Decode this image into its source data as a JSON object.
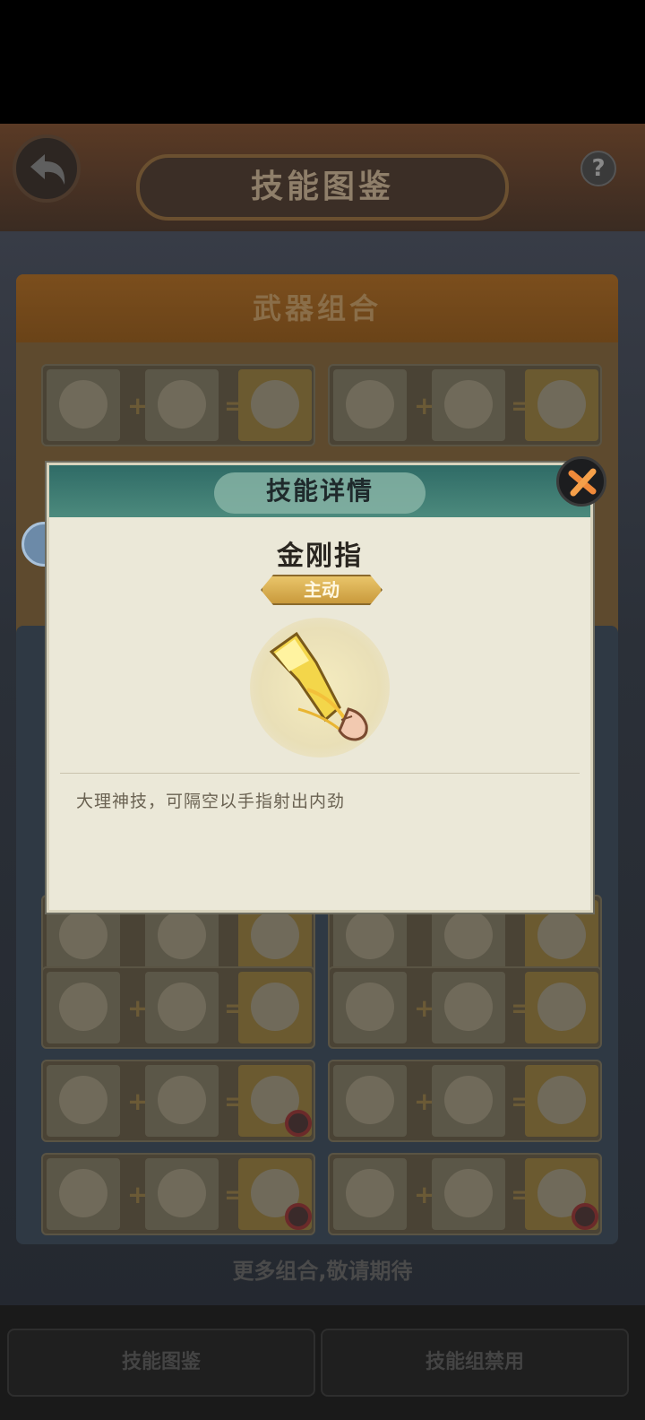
{
  "header": {
    "title": "技能图鉴",
    "help_symbol": "?"
  },
  "weapon_section": {
    "title": "武器组合"
  },
  "combo_ops": {
    "plus": "+",
    "equals": "="
  },
  "footer": {
    "more_text": "更多组合,敬请期待"
  },
  "tabs": [
    {
      "label": "技能图鉴"
    },
    {
      "label": "技能组禁用"
    }
  ],
  "dialog": {
    "title": "技能详情",
    "skill_name": "金刚指",
    "skill_type": "主动",
    "description": "大理神技，可隔空以手指射出内劲"
  },
  "icons": [
    "back-arrow-icon",
    "help-icon",
    "close-icon",
    "golden-finger-skill-icon",
    "ban-icon"
  ]
}
